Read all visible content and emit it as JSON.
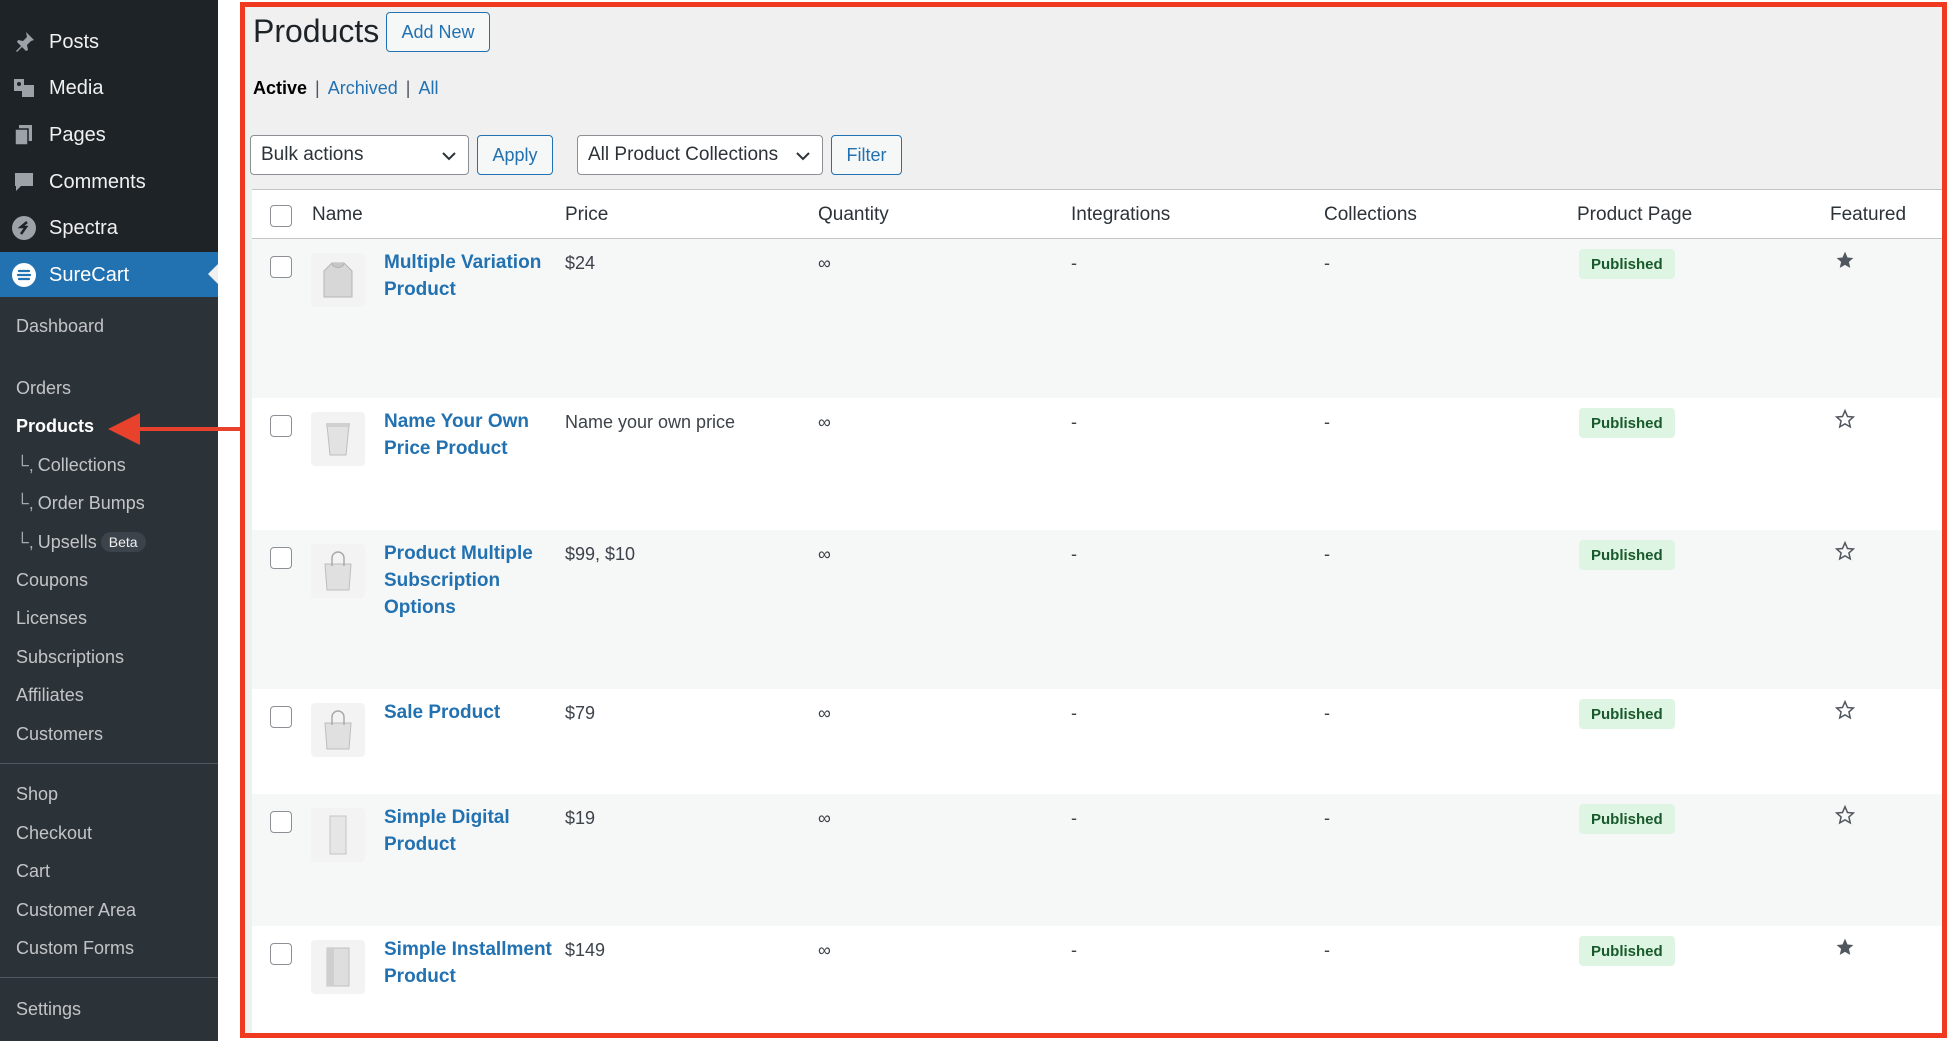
{
  "sidebar": {
    "top_items": [
      {
        "label": "Posts",
        "icon": "pin-icon"
      },
      {
        "label": "Media",
        "icon": "media-icon"
      },
      {
        "label": "Pages",
        "icon": "pages-icon"
      },
      {
        "label": "Comments",
        "icon": "comment-icon"
      },
      {
        "label": "Spectra",
        "icon": "spectra-logo-icon"
      },
      {
        "label": "SureCart",
        "icon": "surecart-logo-icon"
      }
    ],
    "submenu": {
      "dashboard": "Dashboard",
      "orders": "Orders",
      "products": "Products",
      "collections": "Collections",
      "order_bumps": "Order Bumps",
      "upsells": "Upsells",
      "upsells_badge": "Beta",
      "coupons": "Coupons",
      "licenses": "Licenses",
      "subscriptions": "Subscriptions",
      "affiliates": "Affiliates",
      "customers": "Customers",
      "shop": "Shop",
      "checkout": "Checkout",
      "cart": "Cart",
      "customer_area": "Customer Area",
      "custom_forms": "Custom Forms",
      "settings": "Settings"
    }
  },
  "header": {
    "title": "Products",
    "add_new": "Add New"
  },
  "filters": {
    "active": "Active",
    "archived": "Archived",
    "all": "All"
  },
  "toolbar": {
    "bulk_actions": "Bulk actions",
    "apply": "Apply",
    "collections_filter": "All Product Collections",
    "filter": "Filter"
  },
  "table": {
    "columns": [
      "Name",
      "Price",
      "Quantity",
      "Integrations",
      "Collections",
      "Product Page",
      "Featured"
    ],
    "rows": [
      {
        "name": "Multiple Variation Product",
        "price": "$24",
        "quantity": "∞",
        "integrations": "-",
        "collections": "-",
        "page": "Published",
        "featured": true,
        "thumb": "hoodie"
      },
      {
        "name": "Name Your Own Price Product",
        "price": "Name your own price",
        "quantity": "∞",
        "integrations": "-",
        "collections": "-",
        "page": "Published",
        "featured": false,
        "thumb": "cup"
      },
      {
        "name": "Product Multiple Subscription Options",
        "price": "$99, $10",
        "quantity": "∞",
        "integrations": "-",
        "collections": "-",
        "page": "Published",
        "featured": false,
        "thumb": "bag"
      },
      {
        "name": "Sale Product",
        "price": "$79",
        "quantity": "∞",
        "integrations": "-",
        "collections": "-",
        "page": "Published",
        "featured": false,
        "thumb": "bag"
      },
      {
        "name": "Simple Digital Product",
        "price": "$19",
        "quantity": "∞",
        "integrations": "-",
        "collections": "-",
        "page": "Published",
        "featured": false,
        "thumb": "box"
      },
      {
        "name": "Simple Installment Product",
        "price": "$149",
        "quantity": "∞",
        "integrations": "-",
        "collections": "-",
        "page": "Published",
        "featured": true,
        "thumb": "box"
      }
    ]
  },
  "colors": {
    "accent": "#2271b1",
    "sidebar_bg": "#1d2327",
    "annotation": "#f03a1f",
    "badge_bg": "#dff5e4",
    "badge_text": "#185a2b"
  }
}
